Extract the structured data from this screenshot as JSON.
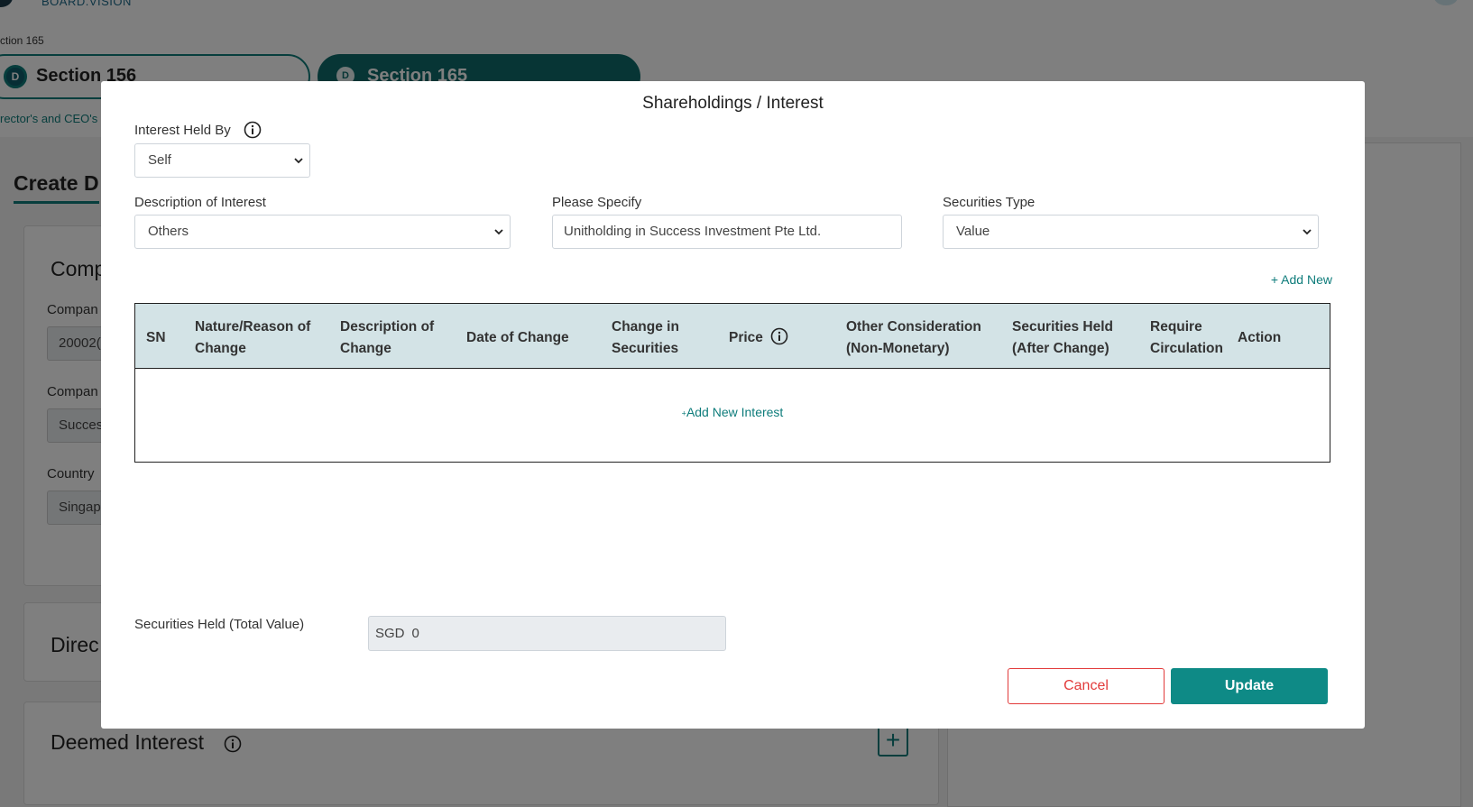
{
  "background": {
    "logo_subtitle": "BOARD.VISION",
    "breadcrumb": "ction 165",
    "tabs": [
      {
        "badge": "D",
        "label": "Section 156"
      },
      {
        "badge": "D",
        "label": "Section 165"
      }
    ],
    "tab_subtitle": "rector's and CEO's",
    "page_heading": "Create D",
    "company_card": {
      "title": "Comp",
      "fields": [
        {
          "label": "Compan",
          "value": "20002("
        },
        {
          "label": "Compan",
          "value": "Succes"
        },
        {
          "label": "Country",
          "value": "Singap"
        }
      ]
    },
    "directors_card_title": "Direc",
    "deemed_interest_title": "Deemed Interest",
    "deemed_interest_add": "+"
  },
  "modal": {
    "title": "Shareholdings / Interest",
    "interest_held_by": {
      "label": "Interest Held By",
      "value": "Self"
    },
    "description_of_interest": {
      "label": "Description of Interest",
      "value": "Others"
    },
    "please_specify": {
      "label": "Please Specify",
      "value": "Unitholding in Success Investment Pte Ltd."
    },
    "securities_type": {
      "label": "Securities Type",
      "value": "Value"
    },
    "add_new": "+ Add New",
    "table": {
      "columns": {
        "sn": "SN",
        "nature_1": "Nature/Reason of",
        "nature_2": "Change",
        "desc_1": "Description of",
        "desc_2": "Change",
        "date": "Date of Change",
        "change_1": "Change in",
        "change_2": "Securities",
        "price": "Price",
        "other_1": "Other Consideration",
        "other_2": "(Non-Monetary)",
        "held_1": "Securities Held",
        "held_2": "(After Change)",
        "req_1": "Require",
        "req_2": "Circulation",
        "action": "Action"
      },
      "add_interest": "Add New Interest"
    },
    "total": {
      "label": "Securities Held (Total Value)",
      "currency": "SGD",
      "value": "0"
    },
    "cancel_label": "Cancel",
    "update_label": "Update"
  },
  "colors": {
    "accent": "#0e8a86",
    "header_bg": "#d3e3e6",
    "cancel": "#e23b3b"
  }
}
